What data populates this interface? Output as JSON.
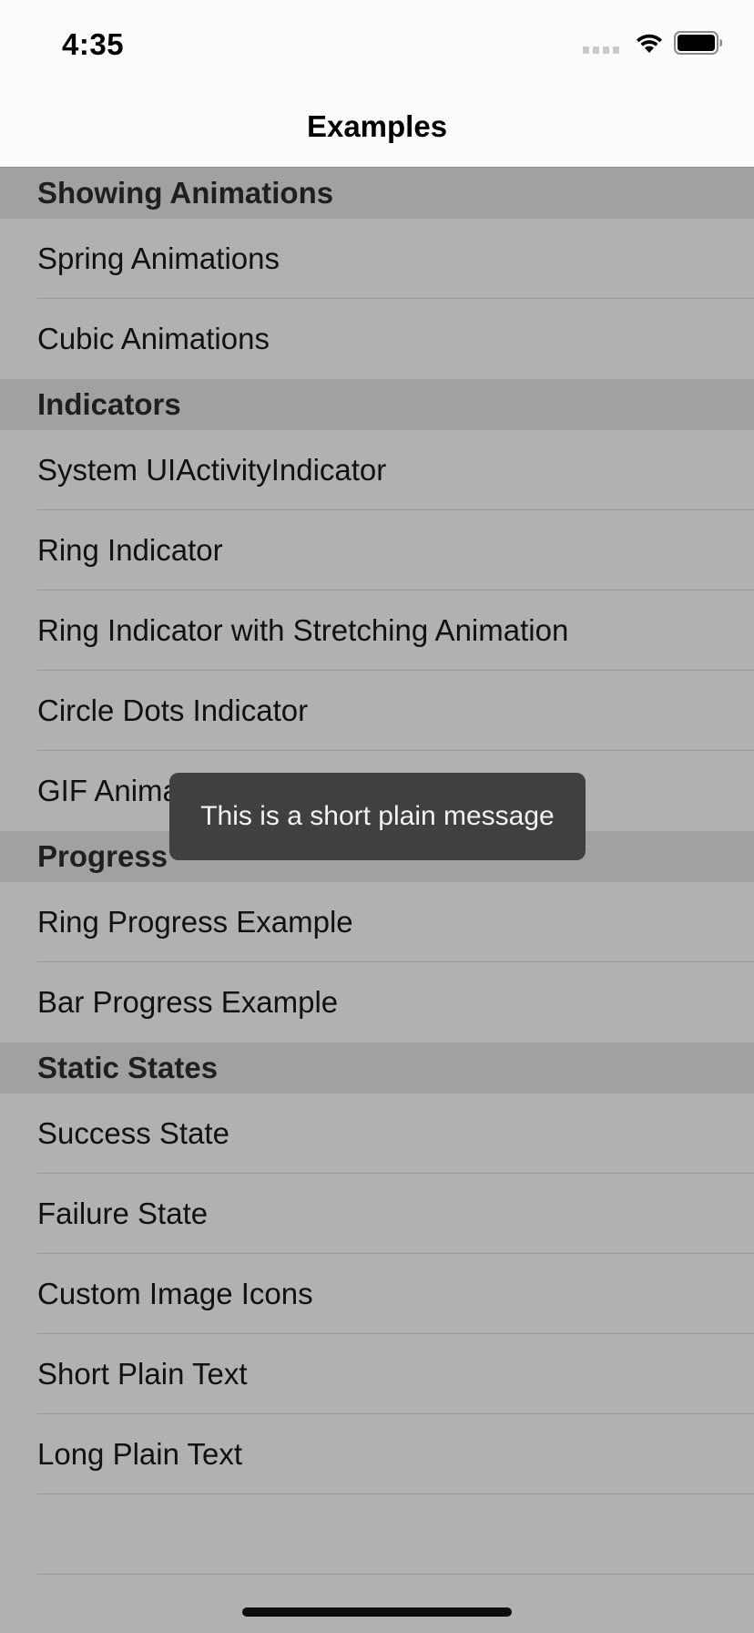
{
  "status_bar": {
    "time": "4:35",
    "icons": [
      "cellular-signal-icon",
      "wifi-icon",
      "battery-icon"
    ]
  },
  "nav": {
    "title": "Examples"
  },
  "sections": [
    {
      "header": "Showing Animations",
      "rows": [
        "Spring Animations",
        "Cubic Animations"
      ]
    },
    {
      "header": "Indicators",
      "rows": [
        "System UIActivityIndicator",
        "Ring Indicator",
        "Ring Indicator with Stretching Animation",
        "Circle Dots Indicator",
        "GIF Animation"
      ]
    },
    {
      "header": "Progress",
      "rows": [
        "Ring Progress Example",
        "Bar Progress Example"
      ]
    },
    {
      "header": "Static States",
      "rows": [
        "Success State",
        "Failure State",
        "Custom Image Icons",
        "Short Plain Text",
        "Long Plain Text"
      ]
    }
  ],
  "toast": {
    "message": "This is a short plain message"
  },
  "colors": {
    "dimmed_background": "#b1b1b1",
    "section_header_background": "#a1a1a1",
    "toast_background": "#404040"
  }
}
